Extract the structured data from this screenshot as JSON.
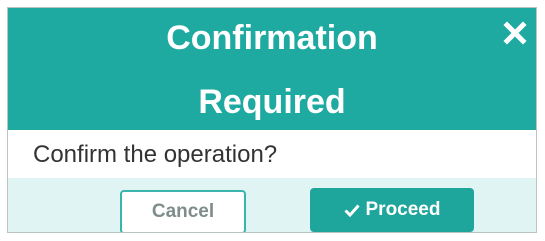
{
  "dialog": {
    "title_line1": "Confirmation",
    "title_line2": "Required",
    "message": "Confirm the operation?",
    "cancel_label": "Cancel",
    "proceed_label": "Proceed",
    "close_icon": "close-icon",
    "proceed_icon": "check-icon"
  },
  "colors": {
    "header": "#1eaaa0",
    "footer": "#dff4f3",
    "accent": "#1ea59c"
  }
}
